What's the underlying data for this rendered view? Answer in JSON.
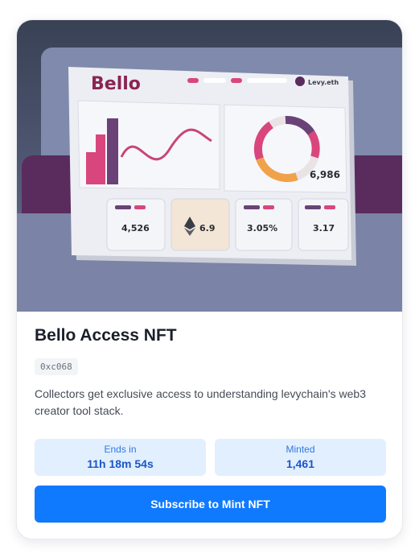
{
  "nft": {
    "title": "Bello Access NFT",
    "address": "0xc068",
    "description": "Collectors get exclusive access to understanding levychain's web3 creator tool stack.",
    "ends_label": "Ends in",
    "ends_value": "11h 18m 54s",
    "minted_label": "Minted",
    "minted_value": "1,461",
    "cta_label": "Subscribe to Mint NFT"
  },
  "artwork": {
    "brand": "Bello",
    "user": "Levy.eth",
    "donut_value": "6,986",
    "tiles": [
      "4,526",
      "6.9",
      "3.05%",
      "3.17"
    ]
  },
  "colors": {
    "primary": "#107aff",
    "stat_bg": "#e2efff",
    "pink": "#d9467d",
    "purple": "#6a4278",
    "orange": "#f0a24a"
  }
}
